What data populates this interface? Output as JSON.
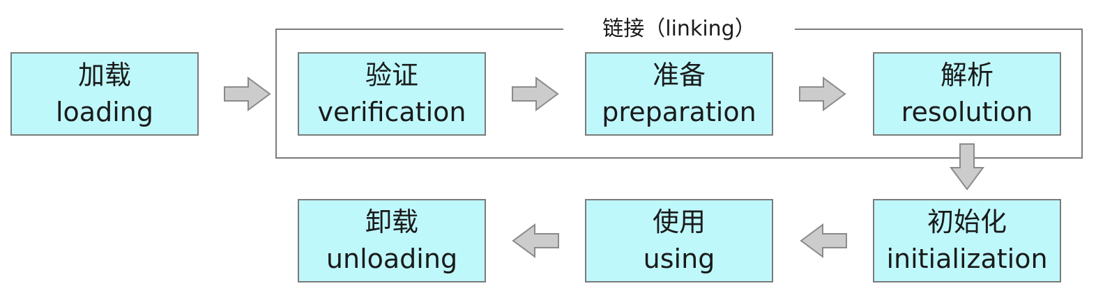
{
  "diagram": {
    "group": {
      "label": "链接（linking）"
    },
    "stages": {
      "loading": {
        "zh": "加载",
        "en": "loading"
      },
      "verification": {
        "zh": "验证",
        "en": "verification"
      },
      "preparation": {
        "zh": "准备",
        "en": "preparation"
      },
      "resolution": {
        "zh": "解析",
        "en": "resolution"
      },
      "initialization": {
        "zh": "初始化",
        "en": "initialization"
      },
      "using": {
        "zh": "使用",
        "en": "using"
      },
      "unloading": {
        "zh": "卸载",
        "en": "unloading"
      }
    },
    "colors": {
      "box_fill": "#bff8fb",
      "box_border": "#7a7a7a",
      "arrow_fill": "#cccccc",
      "arrow_stroke": "#8a8a8a",
      "frame_border": "#7a7a7a"
    },
    "arrows": [
      {
        "from": "loading",
        "to": "verification",
        "direction": "right"
      },
      {
        "from": "verification",
        "to": "preparation",
        "direction": "right"
      },
      {
        "from": "preparation",
        "to": "resolution",
        "direction": "right"
      },
      {
        "from": "resolution",
        "to": "initialization",
        "direction": "down"
      },
      {
        "from": "initialization",
        "to": "using",
        "direction": "left"
      },
      {
        "from": "using",
        "to": "unloading",
        "direction": "left"
      }
    ]
  }
}
